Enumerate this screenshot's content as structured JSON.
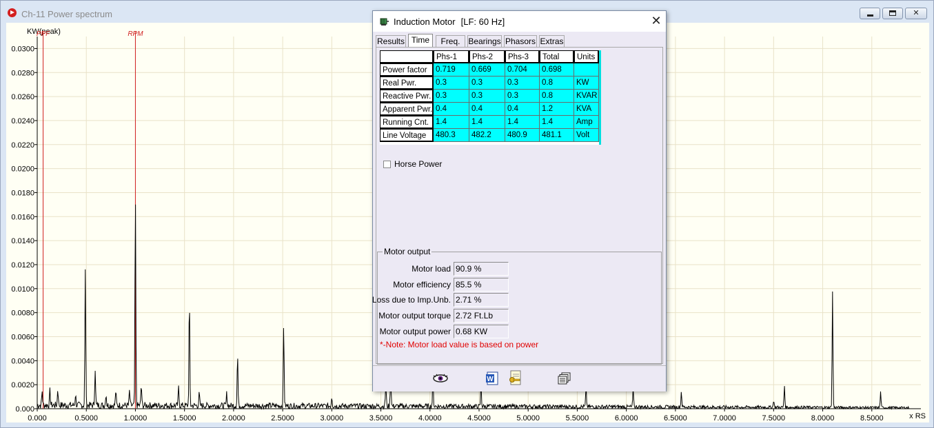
{
  "main_window": {
    "title": "Ch-11 Power spectrum"
  },
  "chart_data": {
    "type": "line",
    "ylabel": "KW(peak)",
    "xlabel": "x RS",
    "xlim": [
      0,
      9.0
    ],
    "ylim": [
      0,
      0.031
    ],
    "x_ticks": [
      "0.000",
      "0.5000",
      "1.0000",
      "1.5000",
      "2.0000",
      "2.5000",
      "3.0000",
      "3.5000",
      "4.0000",
      "4.5000",
      "5.0000",
      "5.5000",
      "6.0000",
      "6.5000",
      "7.0000",
      "7.5000",
      "8.0000",
      "8.5000"
    ],
    "y_ticks": [
      "0.000",
      "0.0020",
      "0.0040",
      "0.0060",
      "0.0080",
      "0.0100",
      "0.0120",
      "0.0140",
      "0.0160",
      "0.0180",
      "0.0200",
      "0.0220",
      "0.0240",
      "0.0260",
      "0.0280",
      "0.0300"
    ],
    "grid": true,
    "markers": [
      {
        "label": "PPF",
        "x": 0.06
      },
      {
        "label": "RPM",
        "x": 1.0
      }
    ],
    "peaks": [
      {
        "x": 0.05,
        "y": 0.0012
      },
      {
        "x": 0.13,
        "y": 0.0012
      },
      {
        "x": 0.21,
        "y": 0.0014
      },
      {
        "x": 0.39,
        "y": 0.0009
      },
      {
        "x": 0.49,
        "y": 0.0113
      },
      {
        "x": 0.59,
        "y": 0.0031
      },
      {
        "x": 0.7,
        "y": 0.001
      },
      {
        "x": 0.8,
        "y": 0.0012
      },
      {
        "x": 0.94,
        "y": 0.0012
      },
      {
        "x": 1.0,
        "y": 0.0174
      },
      {
        "x": 1.06,
        "y": 0.0017
      },
      {
        "x": 1.44,
        "y": 0.0015
      },
      {
        "x": 1.55,
        "y": 0.0089
      },
      {
        "x": 1.65,
        "y": 0.001
      },
      {
        "x": 1.93,
        "y": 0.001
      },
      {
        "x": 2.04,
        "y": 0.0043
      },
      {
        "x": 2.51,
        "y": 0.0067
      },
      {
        "x": 3.0,
        "y": 0.0008
      },
      {
        "x": 3.55,
        "y": 0.002
      },
      {
        "x": 3.6,
        "y": 0.003
      },
      {
        "x": 4.03,
        "y": 0.0025
      },
      {
        "x": 4.52,
        "y": 0.0018
      },
      {
        "x": 5.59,
        "y": 0.0016
      },
      {
        "x": 6.07,
        "y": 0.0015
      },
      {
        "x": 6.56,
        "y": 0.0013
      },
      {
        "x": 7.5,
        "y": 0.0006
      },
      {
        "x": 7.61,
        "y": 0.0018
      },
      {
        "x": 8.1,
        "y": 0.0096
      },
      {
        "x": 8.59,
        "y": 0.0013
      }
    ],
    "baseline_noise": 0.0006
  },
  "dialog": {
    "title": "Induction Motor",
    "title_sub": "[LF: 60 Hz]",
    "tabs": [
      "Results",
      "Time",
      "Freq.",
      "Bearings",
      "Phasors",
      "Extras"
    ],
    "active_tab": "Time",
    "table": {
      "headers": [
        "",
        "Phs-1",
        "Phs-2",
        "Phs-3",
        "Total",
        "Units"
      ],
      "rows": [
        {
          "label": "Power factor",
          "values": [
            "0.719",
            "0.669",
            "0.704",
            "0.698",
            ""
          ]
        },
        {
          "label": "Real Pwr.",
          "values": [
            "0.3",
            "0.3",
            "0.3",
            "0.8",
            "KW"
          ]
        },
        {
          "label": "Reactive Pwr.",
          "values": [
            "0.3",
            "0.3",
            "0.3",
            "0.8",
            "KVAR"
          ]
        },
        {
          "label": "Apparent Pwr.",
          "values": [
            "0.4",
            "0.4",
            "0.4",
            "1.2",
            "KVA"
          ]
        },
        {
          "label": "Running Cnt.",
          "values": [
            "1.4",
            "1.4",
            "1.4",
            "1.4",
            "Amp"
          ]
        },
        {
          "label": "Line Voltage",
          "values": [
            "480.3",
            "482.2",
            "480.9",
            "481.1",
            "Volt"
          ]
        }
      ]
    },
    "horse_power_label": "Horse Power",
    "horse_power_checked": false,
    "motor_output": {
      "legend": "Motor output",
      "fields": [
        {
          "label": "Motor load",
          "value": "90.9 %"
        },
        {
          "label": "Motor efficiency",
          "value": "85.5 %"
        },
        {
          "label": "Loss due to Imp.Unb.",
          "value": "2.71 %"
        },
        {
          "label": "Motor output torque",
          "value": "2.72 Ft.Lb"
        },
        {
          "label": "Motor output power",
          "value": "0.68 KW"
        }
      ],
      "note": "*-Note: Motor load value is based on power"
    },
    "toolbar_icons": [
      "eye-icon",
      "word-export-icon",
      "report-key-icon",
      "copy-pages-icon"
    ]
  },
  "colors": {
    "plot_background": "#fffff4",
    "grid_line": "#e9e2c8",
    "marker_line": "#d02020",
    "table_value_bg": "#00ffff"
  }
}
